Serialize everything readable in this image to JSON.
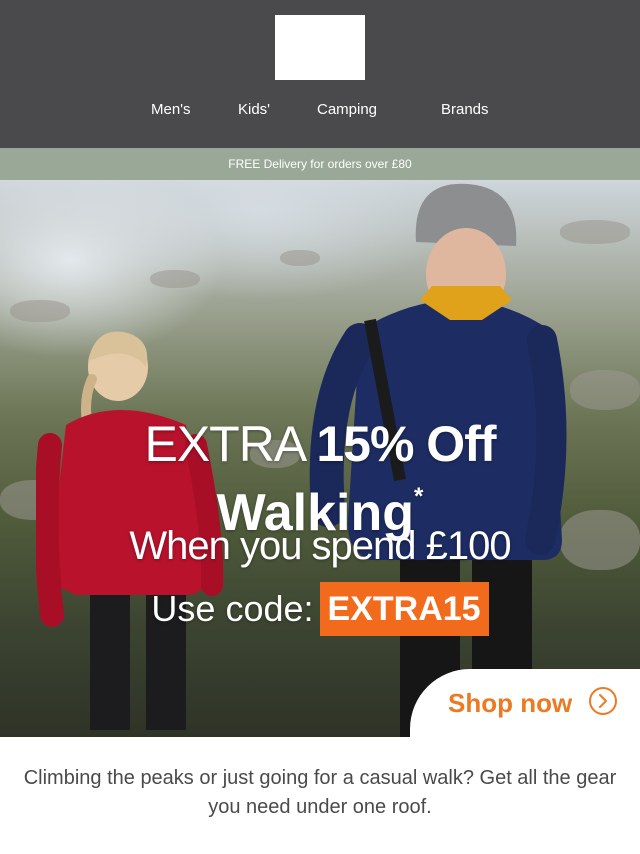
{
  "header": {
    "nav": [
      {
        "label": "Men's"
      },
      {
        "label": "Kids'"
      },
      {
        "label": "Camping"
      },
      {
        "label": "Brands"
      }
    ]
  },
  "promo_bar": {
    "text": "FREE Delivery for orders over £80"
  },
  "hero": {
    "line1_light": "EXTRA",
    "line1_bold": "15% Off",
    "line2": "Walking",
    "line2_mark": "*",
    "line3": "When you spend £100",
    "code_label": "Use code:",
    "code": "EXTRA15",
    "cta_label": "Shop now",
    "cta_icon": "chevron-right-icon"
  },
  "body_copy": "Climbing the peaks or just going for a casual walk? Get all the gear you need under one roof.",
  "colors": {
    "header_bg": "#4a4a4c",
    "promo_bar_bg": "#9aa897",
    "accent_orange": "#f26a1b",
    "cta_text": "#ec7a23"
  }
}
